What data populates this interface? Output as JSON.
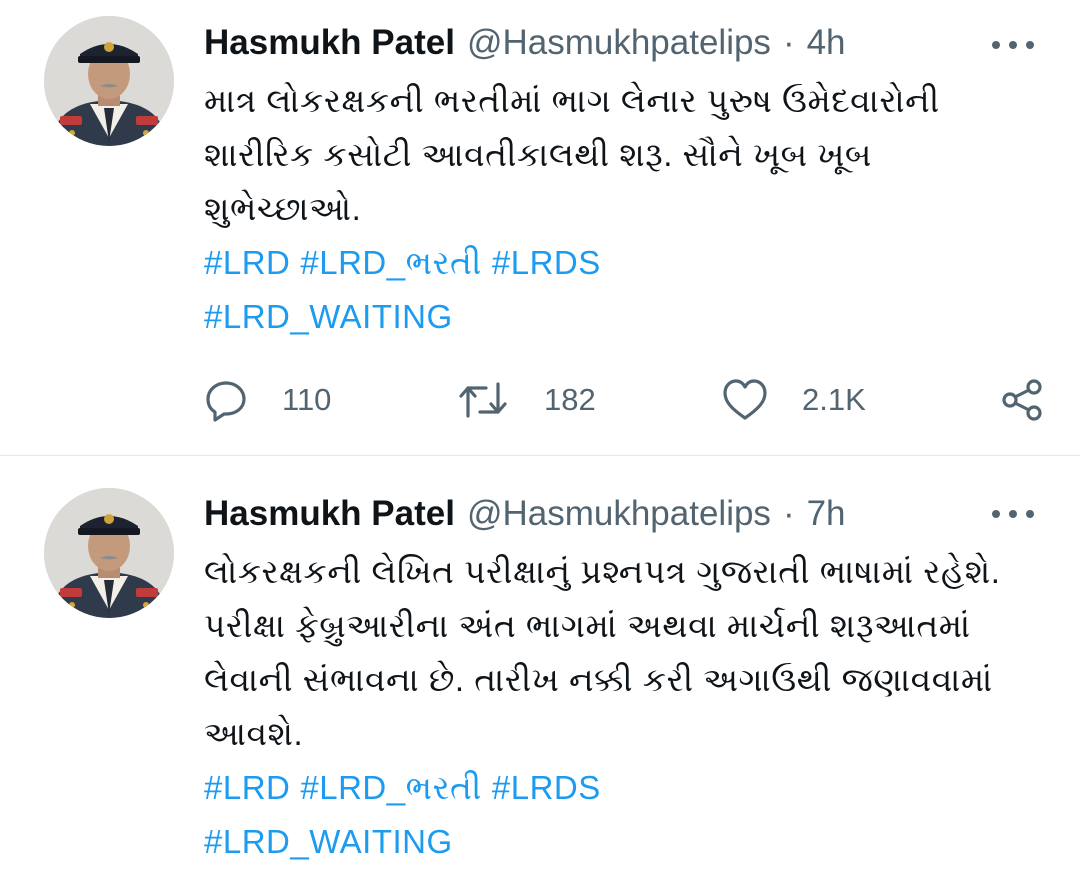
{
  "tweets": [
    {
      "author": "Hasmukh Patel",
      "handle": "@Hasmukhpatelips",
      "separator": "·",
      "time": "4h",
      "lines": [
        "માત્ર લોકરક્ષકની ભરતીમાં ભાગ લેનાર પુરુષ ઉમેદવારોની",
        "શારીરિક કસોટી આવતીકાલથી શરૂ. સૌને ખૂબ ખૂબ",
        "શુભેચ્છાઓ."
      ],
      "hashtags_line1": [
        "#LRD",
        "#LRD_ભરતી",
        "#LRDS"
      ],
      "hashtags_line2": [
        "#LRD_WAITING"
      ],
      "replies": "110",
      "retweets": "182",
      "likes": "2.1K"
    },
    {
      "author": "Hasmukh Patel",
      "handle": "@Hasmukhpatelips",
      "separator": "·",
      "time": "7h",
      "lines": [
        "લોકરક્ષકની લેખિત પરીક્ષાનું પ્રશ્નપત્ર ગુજરાતી ભાષામાં રહેશે.",
        "પરીક્ષા ફેબ્રુઆરીના અંત ભાગમાં અથવા માર્ચની શરૂઆતમાં",
        "લેવાની સંભાવના છે. તારીખ નક્કી કરી અગાઉથી જણાવવામાં",
        "આવશે."
      ],
      "hashtags_line1": [
        "#LRD",
        "#LRD_ભરતી",
        "#LRDS"
      ],
      "hashtags_line2": [
        "#LRD_WAITING"
      ]
    }
  ],
  "icons": {
    "reply": "reply-icon",
    "retweet": "retweet-icon",
    "like": "heart-icon",
    "share": "share-icon",
    "more": "more-icon"
  },
  "colors": {
    "accent": "#1d9bf0",
    "secondary_text": "#536471",
    "primary_text": "#0f1419"
  }
}
